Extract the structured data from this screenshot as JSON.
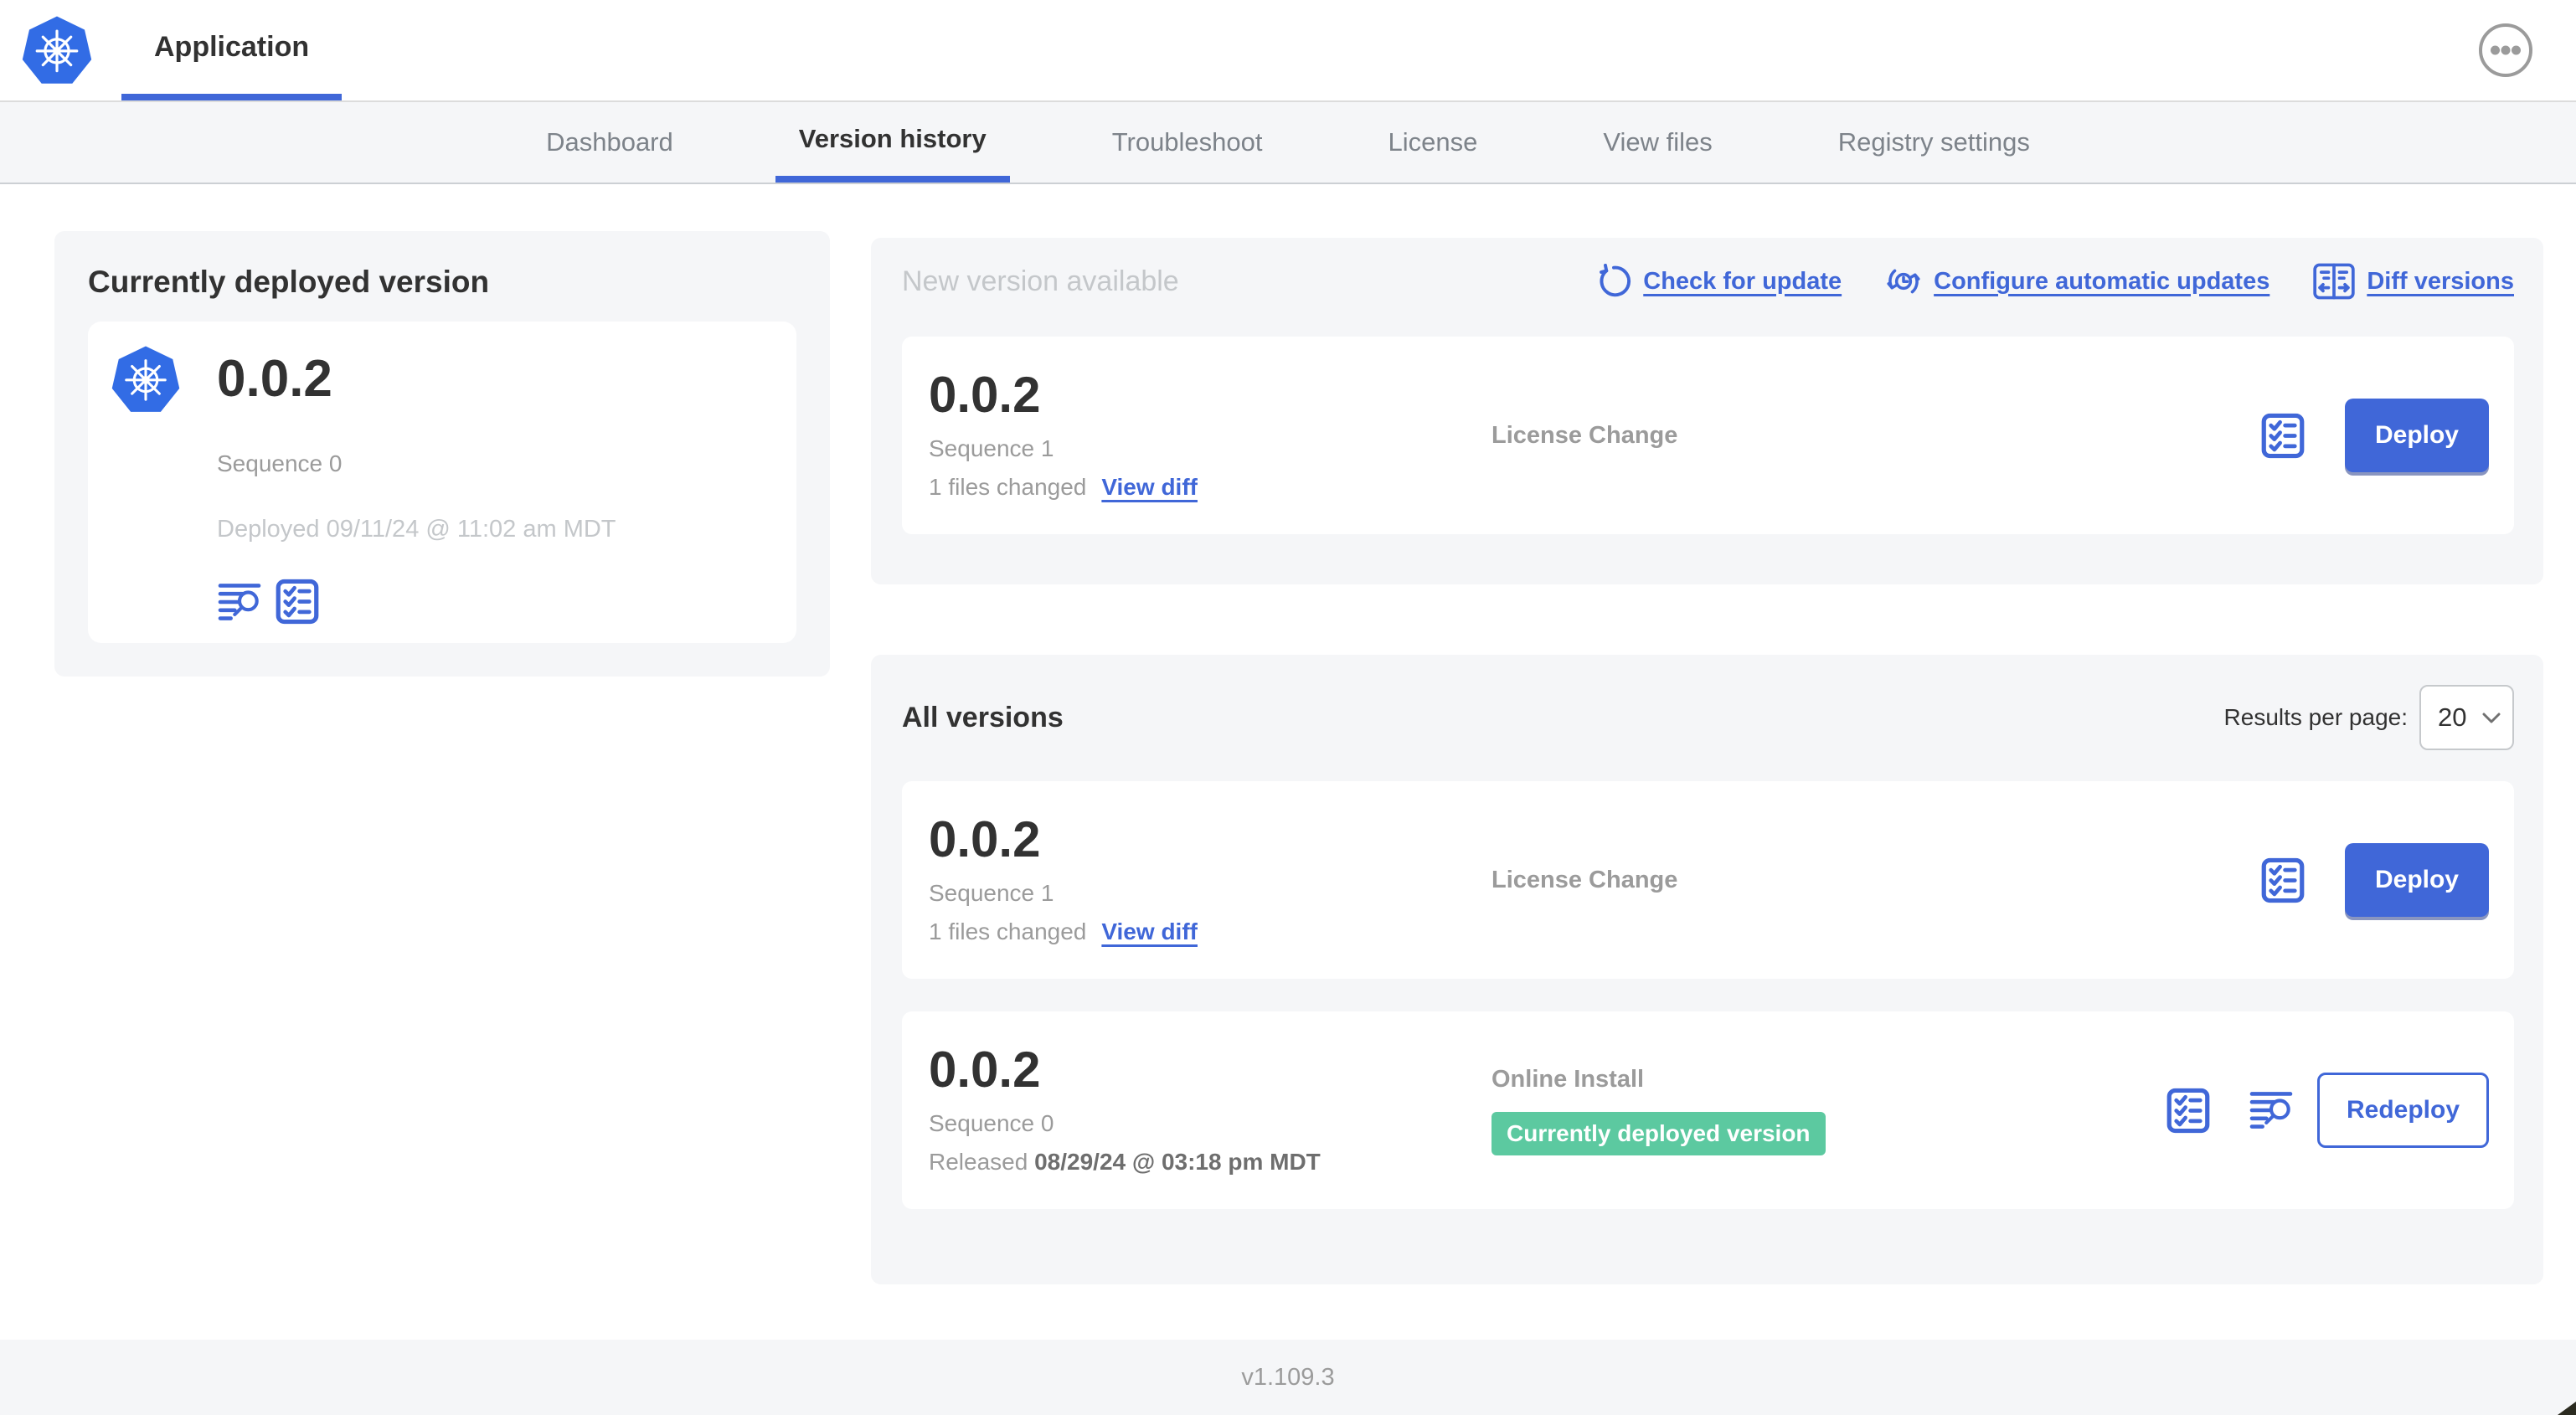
{
  "colors": {
    "accent": "#4067d8",
    "k8s_blue": "#326ce5",
    "badge_green": "#5cc9a0"
  },
  "header": {
    "app_tab": "Application"
  },
  "nav_tabs": [
    {
      "label": "Dashboard",
      "active": false
    },
    {
      "label": "Version history",
      "active": true
    },
    {
      "label": "Troubleshoot",
      "active": false
    },
    {
      "label": "License",
      "active": false
    },
    {
      "label": "View files",
      "active": false
    },
    {
      "label": "Registry settings",
      "active": false
    }
  ],
  "current_deployed": {
    "heading": "Currently deployed version",
    "version": "0.0.2",
    "sequence": "Sequence 0",
    "deployed_at": "Deployed 09/11/24 @ 11:02 am MDT"
  },
  "new_version": {
    "heading": "New version available",
    "links": {
      "check": "Check for update",
      "configure": "Configure automatic updates",
      "diff": "Diff versions"
    },
    "row": {
      "version": "0.0.2",
      "sequence": "Sequence 1",
      "files_changed": "1 files changed",
      "view_diff": "View diff",
      "source": "License Change",
      "deploy": "Deploy"
    }
  },
  "all_versions": {
    "heading": "All versions",
    "results_per_page_label": "Results per page:",
    "results_per_page_value": "20",
    "rows": [
      {
        "version": "0.0.2",
        "sequence": "Sequence 1",
        "files_changed": "1 files changed",
        "view_diff": "View diff",
        "source": "License Change",
        "deploy": "Deploy"
      },
      {
        "version": "0.0.2",
        "sequence": "Sequence 0",
        "released_prefix": "Released",
        "released_date": "08/29/24 @ 03:18 pm MDT",
        "source": "Online Install",
        "badge": "Currently deployed version",
        "redeploy": "Redeploy"
      }
    ]
  },
  "footer": {
    "app_version": "v1.109.3"
  }
}
